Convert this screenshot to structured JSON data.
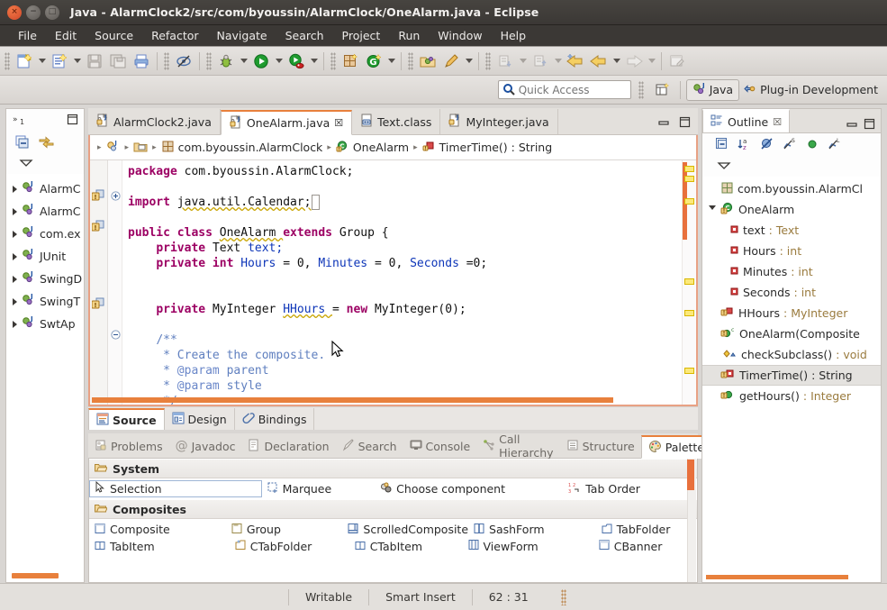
{
  "window": {
    "title": "Java - AlarmClock2/src/com/byoussin/AlarmClock/OneAlarm.java - Eclipse",
    "close_label": "×",
    "min_label": "−",
    "max_label": "□"
  },
  "menubar": {
    "items": [
      {
        "label": "File"
      },
      {
        "label": "Edit"
      },
      {
        "label": "Source"
      },
      {
        "label": "Refactor"
      },
      {
        "label": "Navigate"
      },
      {
        "label": "Search"
      },
      {
        "label": "Project"
      },
      {
        "label": "Run"
      },
      {
        "label": "Window"
      },
      {
        "label": "Help"
      }
    ]
  },
  "toolbar": {
    "icons": [
      {
        "name": "new-java-project-icon"
      },
      {
        "name": "new-java-class-icon"
      },
      {
        "name": "save-icon"
      },
      {
        "name": "save-all-icon"
      },
      {
        "name": "print-icon"
      },
      {
        "name": "toggle-mark-occurrences-icon"
      },
      {
        "name": "debug-icon"
      },
      {
        "name": "run-icon"
      },
      {
        "name": "run-coverage-icon"
      },
      {
        "name": "new-window-builder-icon"
      },
      {
        "name": "external-tools-icon"
      },
      {
        "name": "open-type-icon"
      },
      {
        "name": "quick-fix-icon"
      },
      {
        "name": "next-annotation-icon"
      },
      {
        "name": "previous-annotation-icon"
      },
      {
        "name": "back-icon"
      },
      {
        "name": "forward-icon"
      },
      {
        "name": "new-editor-icon"
      }
    ]
  },
  "quick_access": {
    "placeholder": "Quick Access",
    "value": "",
    "icon": "search-icon"
  },
  "perspectives": {
    "open_perspective_icon": "open-perspective-icon",
    "items": [
      {
        "label": "Java",
        "icon": "java-perspective-icon",
        "active": true
      },
      {
        "label": "Plug-in Development",
        "icon": "plugin-perspective-icon",
        "active": false
      }
    ]
  },
  "package_explorer": {
    "header_icon": "restore-icon",
    "minimize_icon": "minimize-icon",
    "collapse_all_icon": "collapse-all-icon",
    "link-with-editor_icon": "link-with-editor-icon",
    "view_menu_icon": "view-menu-icon",
    "items": [
      {
        "label": "AlarmC"
      },
      {
        "label": "AlarmC"
      },
      {
        "label": "com.ex"
      },
      {
        "label": "JUnit"
      },
      {
        "label": "SwingD"
      },
      {
        "label": "SwingT"
      },
      {
        "label": "SwtAp"
      }
    ]
  },
  "editor": {
    "tabs": [
      {
        "label": "AlarmClock2.java",
        "icon": "java-file-icon",
        "active": false,
        "closable": false
      },
      {
        "label": "OneAlarm.java",
        "icon": "java-file-icon",
        "active": true,
        "closable": true,
        "close_glyph": "☒"
      },
      {
        "label": "Text.class",
        "icon": "class-file-icon",
        "active": false,
        "closable": false
      },
      {
        "label": "MyInteger.java",
        "icon": "java-file-icon",
        "active": false,
        "closable": false
      }
    ],
    "minimize_icon": "minimize-icon",
    "maximize_icon": "maximize-icon",
    "breadcrumb": [
      {
        "label": "",
        "icon": "project-icon"
      },
      {
        "label": "",
        "icon": "source-folder-icon"
      },
      {
        "label": "com.byoussin.AlarmClock",
        "icon": "package-icon"
      },
      {
        "label": "OneAlarm",
        "icon": "class-icon"
      },
      {
        "label": "TimerTime() : String",
        "icon": "method-icon"
      }
    ],
    "breadcrumb_separator": "▸",
    "code_lines": [
      {
        "indent": 1,
        "tokens": [
          {
            "t": "package ",
            "c": "kw"
          },
          {
            "t": "com.byoussin.AlarmClock;",
            "c": "plain"
          }
        ]
      },
      {
        "indent": 0,
        "tokens": []
      },
      {
        "indent": 0,
        "tokens": [
          {
            "t": "import ",
            "c": "kw"
          },
          {
            "t": "java.util.Calendar;",
            "c": "plain"
          }
        ]
      },
      {
        "indent": 0,
        "tokens": []
      },
      {
        "indent": 0,
        "tokens": [
          {
            "t": "public class ",
            "c": "kw"
          },
          {
            "t": "OneAlarm ",
            "c": "plain"
          },
          {
            "t": "extends ",
            "c": "kw"
          },
          {
            "t": "Group {",
            "c": "plain"
          }
        ]
      },
      {
        "indent": 1,
        "tokens": [
          {
            "t": "private ",
            "c": "kw"
          },
          {
            "t": "Text ",
            "c": "plain"
          },
          {
            "t": "text;",
            "c": "fld"
          }
        ]
      },
      {
        "indent": 1,
        "tokens": [
          {
            "t": "private int ",
            "c": "kw"
          },
          {
            "t": "Hours ",
            "c": "fld"
          },
          {
            "t": "= 0, ",
            "c": "plain"
          },
          {
            "t": "Minutes ",
            "c": "fld"
          },
          {
            "t": "= 0, ",
            "c": "plain"
          },
          {
            "t": "Seconds ",
            "c": "fld"
          },
          {
            "t": "=0;",
            "c": "plain"
          }
        ]
      },
      {
        "indent": 0,
        "tokens": []
      },
      {
        "indent": 0,
        "tokens": []
      },
      {
        "indent": 1,
        "tokens": [
          {
            "t": "private ",
            "c": "kw"
          },
          {
            "t": "MyInteger ",
            "c": "plain"
          },
          {
            "t": "HHours ",
            "c": "fld"
          },
          {
            "t": "= ",
            "c": "plain"
          },
          {
            "t": "new ",
            "c": "kw"
          },
          {
            "t": "MyInteger(0);",
            "c": "plain"
          }
        ]
      },
      {
        "indent": 0,
        "tokens": []
      },
      {
        "indent": 1,
        "tokens": [
          {
            "t": "/**",
            "c": "cmt"
          }
        ]
      },
      {
        "indent": 1,
        "tokens": [
          {
            "t": " * Create the composite.",
            "c": "cmt"
          }
        ]
      },
      {
        "indent": 1,
        "tokens": [
          {
            "t": " * ",
            "c": "cmt"
          },
          {
            "t": "@param ",
            "c": "tag"
          },
          {
            "t": "parent",
            "c": "cmt"
          }
        ]
      },
      {
        "indent": 1,
        "tokens": [
          {
            "t": " * ",
            "c": "cmt"
          },
          {
            "t": "@param ",
            "c": "tag"
          },
          {
            "t": "style",
            "c": "cmt"
          }
        ]
      },
      {
        "indent": 1,
        "tokens": [
          {
            "t": " */",
            "c": "cmt"
          }
        ]
      }
    ],
    "bottom_tabs": [
      {
        "label": "Source",
        "icon": "source-icon",
        "active": true
      },
      {
        "label": "Design",
        "icon": "design-icon",
        "active": false
      },
      {
        "label": "Bindings",
        "icon": "bindings-icon",
        "active": false
      }
    ]
  },
  "outline": {
    "tab_label": "Outline",
    "tab_icon": "outline-icon",
    "close_glyph": "☒",
    "minimize_icon": "minimize-icon",
    "maximize_icon": "maximize-icon",
    "tools": [
      {
        "name": "collapse-all-icon"
      },
      {
        "name": "sort-icon"
      },
      {
        "name": "hide-fields-icon"
      },
      {
        "name": "hide-static-icon"
      },
      {
        "name": "hide-non-public-icon"
      },
      {
        "name": "hide-local-types-icon"
      }
    ],
    "view_menu_icon": "view-menu-icon",
    "items": [
      {
        "label": "com.byoussin.AlarmCl",
        "icon": "package-icon",
        "indent": 1,
        "twisty": "none",
        "selected": false,
        "type": ""
      },
      {
        "label": "OneAlarm",
        "icon": "class-warning-icon",
        "indent": 0,
        "twisty": "open",
        "selected": false,
        "type": ""
      },
      {
        "label": "text",
        "type": " : Text",
        "icon": "field-private-icon",
        "indent": 2,
        "twisty": "none",
        "selected": false
      },
      {
        "label": "Hours",
        "type": " : int",
        "icon": "field-private-icon",
        "indent": 2,
        "twisty": "none",
        "selected": false
      },
      {
        "label": "Minutes",
        "type": " : int",
        "icon": "field-private-icon",
        "indent": 2,
        "twisty": "none",
        "selected": false
      },
      {
        "label": "Seconds",
        "type": " : int",
        "icon": "field-private-icon",
        "indent": 2,
        "twisty": "none",
        "selected": false
      },
      {
        "label": "HHours",
        "type": " : MyInteger",
        "icon": "field-warning-icon",
        "indent": 1,
        "twisty": "none",
        "selected": false
      },
      {
        "label": "OneAlarm(Composite",
        "type": "",
        "icon": "constructor-icon",
        "indent": 1,
        "twisty": "none",
        "selected": false
      },
      {
        "label": "checkSubclass()",
        "type": " : void",
        "icon": "method-protected-icon",
        "indent": 1,
        "twisty": "none",
        "selected": false
      },
      {
        "label": "TimerTime()",
        "type": " : String",
        "icon": "method-warning-icon",
        "indent": 1,
        "twisty": "none",
        "selected": true
      },
      {
        "label": "getHours()",
        "type": " : Integer",
        "icon": "method-public-icon",
        "indent": 1,
        "twisty": "none",
        "selected": false
      }
    ]
  },
  "bottom_view": {
    "tabs": [
      {
        "label": "Problems",
        "icon": "problems-icon",
        "active": false
      },
      {
        "label": "Javadoc",
        "icon": "javadoc-icon",
        "active": false
      },
      {
        "label": "Declaration",
        "icon": "declaration-icon",
        "active": false
      },
      {
        "label": "Search",
        "icon": "search-view-icon",
        "active": false
      },
      {
        "label": "Console",
        "icon": "console-icon",
        "active": false
      },
      {
        "label": "Call Hierarchy",
        "icon": "call-hierarchy-icon",
        "active": false
      },
      {
        "label": "Structure",
        "icon": "structure-icon",
        "active": false
      },
      {
        "label": "Palette",
        "icon": "palette-icon",
        "active": true,
        "close_glyph": "☒"
      }
    ],
    "minimize_icon": "minimize-icon",
    "maximize_icon": "maximize-icon",
    "palette": {
      "categories": [
        {
          "label": "System",
          "icon": "folder-open-icon",
          "rows": [
            [
              {
                "label": "Selection",
                "icon": "selection-icon",
                "selected": true
              },
              {
                "label": "Marquee",
                "icon": "marquee-icon",
                "selected": false
              },
              {
                "label": "Choose component",
                "icon": "choose-component-icon",
                "selected": false
              },
              {
                "label": "Tab Order",
                "icon": "tab-order-icon",
                "selected": false
              }
            ]
          ]
        },
        {
          "label": "Composites",
          "icon": "folder-open-icon",
          "rows": [
            [
              {
                "label": "Composite",
                "icon": "composite-icon",
                "selected": false
              },
              {
                "label": "Group",
                "icon": "group-icon",
                "selected": false
              },
              {
                "label": "ScrolledComposite",
                "icon": "scrolled-composite-icon",
                "selected": false
              },
              {
                "label": "SashForm",
                "icon": "sashform-icon",
                "selected": false
              },
              {
                "label": "TabFolder",
                "icon": "tabfolder-icon",
                "selected": false
              }
            ],
            [
              {
                "label": "TabItem",
                "icon": "tabitem-icon",
                "selected": false
              },
              {
                "label": "CTabFolder",
                "icon": "ctabfolder-icon",
                "selected": false
              },
              {
                "label": "CTabItem",
                "icon": "ctabitem-icon",
                "selected": false
              },
              {
                "label": "ViewForm",
                "icon": "viewform-icon",
                "selected": false
              },
              {
                "label": "CBanner",
                "icon": "cbanner-icon",
                "selected": false
              }
            ]
          ]
        }
      ]
    }
  },
  "statusbar": {
    "writable": "Writable",
    "insert_mode": "Smart Insert",
    "position": "62 : 31"
  },
  "colors": {
    "accent_orange": "#e8803c",
    "titlebar_bg": "#3b3835",
    "keyword": "#9c0063",
    "field": "#0d35b8",
    "comment": "#5f7fbf",
    "selection_gray": "#e4e2df"
  }
}
